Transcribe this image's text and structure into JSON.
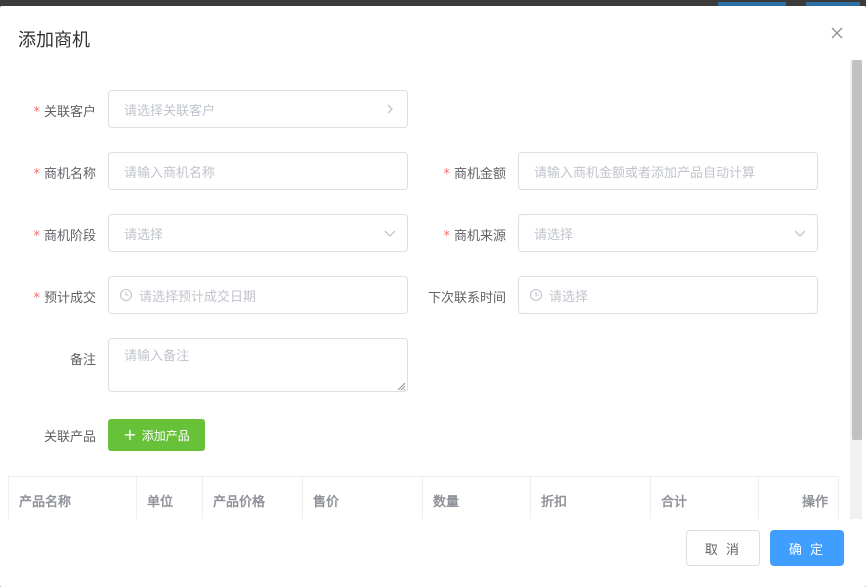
{
  "dialog": {
    "title": "添加商机"
  },
  "form": {
    "related_customer": {
      "label": "关联客户",
      "placeholder": "请选择关联客户",
      "required": true
    },
    "opportunity_name": {
      "label": "商机名称",
      "placeholder": "请输入商机名称",
      "required": true
    },
    "opportunity_amount": {
      "label": "商机金额",
      "placeholder": "请输入商机金额或者添加产品自动计算",
      "required": true
    },
    "opportunity_stage": {
      "label": "商机阶段",
      "placeholder": "请选择",
      "required": true
    },
    "opportunity_source": {
      "label": "商机来源",
      "placeholder": "请选择",
      "required": true
    },
    "expected_deal": {
      "label": "预计成交",
      "placeholder": "请选择预计成交日期",
      "required": true
    },
    "next_contact": {
      "label": "下次联系时间",
      "placeholder": "请选择",
      "required": false
    },
    "remark": {
      "label": "备注",
      "placeholder": "请输入备注",
      "required": false
    },
    "related_products": {
      "label": "关联产品",
      "add_button": "添加产品"
    }
  },
  "required_mark": "*",
  "table": {
    "columns": [
      "产品名称",
      "单位",
      "产品价格",
      "售价",
      "数量",
      "折扣",
      "合计",
      "操作"
    ]
  },
  "footer": {
    "cancel": "取 消",
    "confirm": "确 定"
  },
  "colors": {
    "primary": "#409eff",
    "success": "#67c23a",
    "required": "#f56c6c"
  },
  "icons": {
    "close": "close-icon",
    "arrow_right": "chevron-right-icon",
    "arrow_down": "chevron-down-icon",
    "clock": "clock-icon",
    "plus": "plus-icon"
  }
}
